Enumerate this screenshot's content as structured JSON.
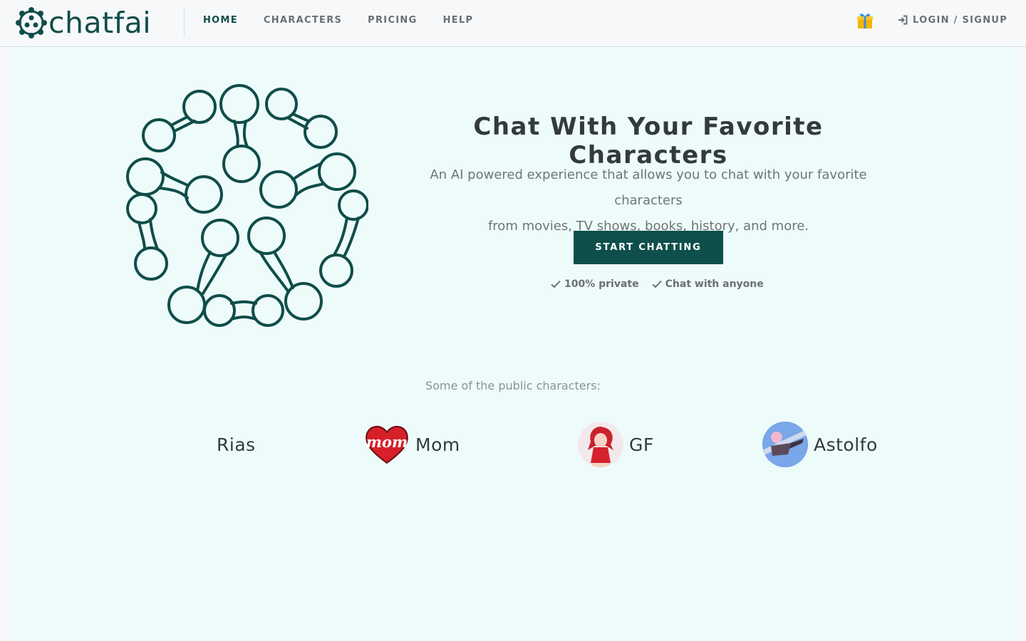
{
  "header": {
    "brand": "chatfai",
    "nav": [
      {
        "label": "HOME",
        "active": true
      },
      {
        "label": "CHARACTERS",
        "active": false
      },
      {
        "label": "PRICING",
        "active": false
      },
      {
        "label": "HELP",
        "active": false
      }
    ],
    "gift_icon": "gift-icon",
    "login_label": "LOGIN / SIGNUP"
  },
  "hero": {
    "title": "Chat With Your Favorite Characters",
    "description_line1": "An AI powered experience that allows you to chat with your favorite characters",
    "description_line2": "from movies, TV shows, books, history, and more.",
    "cta_label": "START CHATTING",
    "features": [
      "100% private",
      "Chat with anyone"
    ]
  },
  "characters": {
    "label": "Some of the public characters:",
    "items": [
      {
        "name": "Rias",
        "avatar": "none"
      },
      {
        "name": "Mom",
        "avatar": "heart-mom-avatar",
        "avatar_text": "mom"
      },
      {
        "name": "GF",
        "avatar": "anime-girl-avatar"
      },
      {
        "name": "Astolfo",
        "avatar": "anime-character-avatar"
      }
    ]
  },
  "colors": {
    "brand": "#0f4d4a",
    "cta_bg": "#0e4f4b",
    "hero_bg": "#edfcfa",
    "page_bg": "#f7f8fa",
    "nav_text": "#6b6f73",
    "gift": "#f5b400"
  }
}
